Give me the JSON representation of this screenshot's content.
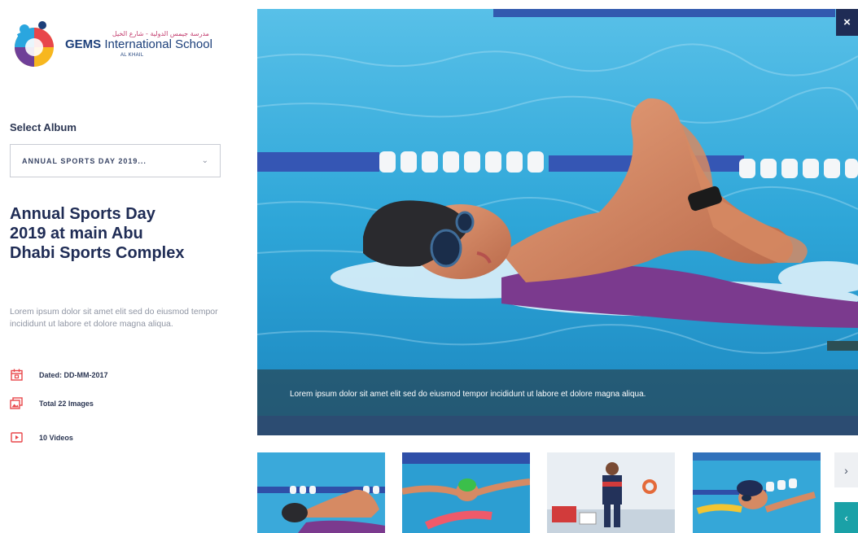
{
  "logo": {
    "arabic": "مدرسة جيمس الدولية - شارع الخيل",
    "name_bold": "GEMS",
    "name_rest": " International School",
    "sub": "AL KHAIL"
  },
  "select": {
    "label": "Select Album",
    "value": "ANNUAL SPORTS DAY 2019...",
    "chevron": "⌄"
  },
  "album": {
    "title": "Annual Sports Day 2019 at main Abu Dhabi Sports Complex",
    "description": "Lorem ipsum dolor sit amet elit sed do eiusmod tempor incididunt ut labore et dolore magna aliqua.",
    "dated": "Dated: DD-MM-2017",
    "total_images": "Total 22 Images",
    "videos": "10 Videos"
  },
  "viewer": {
    "caption": "Lorem ipsum dolor sit amet elit sed do eiusmod tempor incididunt ut labore et dolore magna aliqua.",
    "close_label": "×"
  },
  "carousel": {
    "next_label": "›",
    "prev_label": "‹"
  },
  "colors": {
    "navy": "#1f2c55",
    "teal": "#1aa1a7",
    "accent_red": "#e8464a",
    "pool_blue": "#2f9fd0"
  }
}
